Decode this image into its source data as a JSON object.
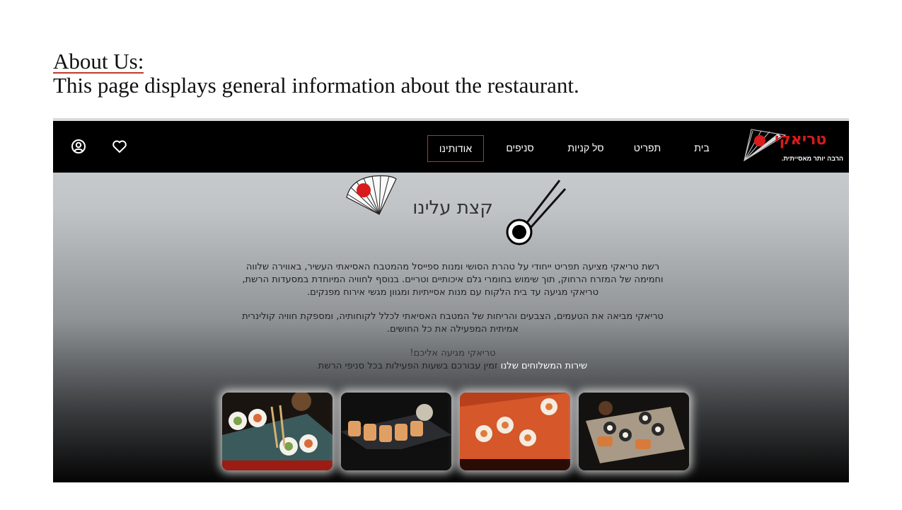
{
  "slide": {
    "title": "About Us:",
    "description": "This page displays general information about the restaurant."
  },
  "nav": {
    "items": [
      {
        "label": "בית"
      },
      {
        "label": "תפריט"
      },
      {
        "label": "סל קניות"
      },
      {
        "label": "סניפים"
      },
      {
        "label": "אודותינו",
        "active": true
      }
    ],
    "logo_text": "טריאקי",
    "logo_tagline": "הרבה יותר מאסייתית.",
    "icons": [
      "user-icon",
      "heart-icon"
    ]
  },
  "content": {
    "heading": "קצת עלינו",
    "paragraph1": "רשת טריאקי מציעה תפריט ייחודי על טהרת הסושי ומנות ספייסל מהמטבח האסיאתי העשיר, באווירה שלווה וחמימה של המזרח הרחוק, תוך שימוש בחומרי גלם איכותיים וטריים. בנוסף לחוויה המיוחדת במסעדות הרשת, טריאקי מגיעה עד בית הלקוח עם מנות אסייתיות ומגוון מגשי אירוח מפנקים.",
    "paragraph2": "טריאקי מביאה את הטעמים, הצבעים והריחות של המטבח האסיאתי לכלל לקוחותיה, ומספקת חוויה קולינרית אמיתית המפעילה את כל החושים.",
    "paragraph3": "טריאקי מגיעה אליכם!",
    "delivery_highlight": "שירות המשלוחים שלנו",
    "delivery_rest": "זמין עבורכם בשעות הפעילות בכל סניפי הרשת"
  },
  "colors": {
    "accent": "#d81b1b",
    "navbar": "#000000"
  }
}
